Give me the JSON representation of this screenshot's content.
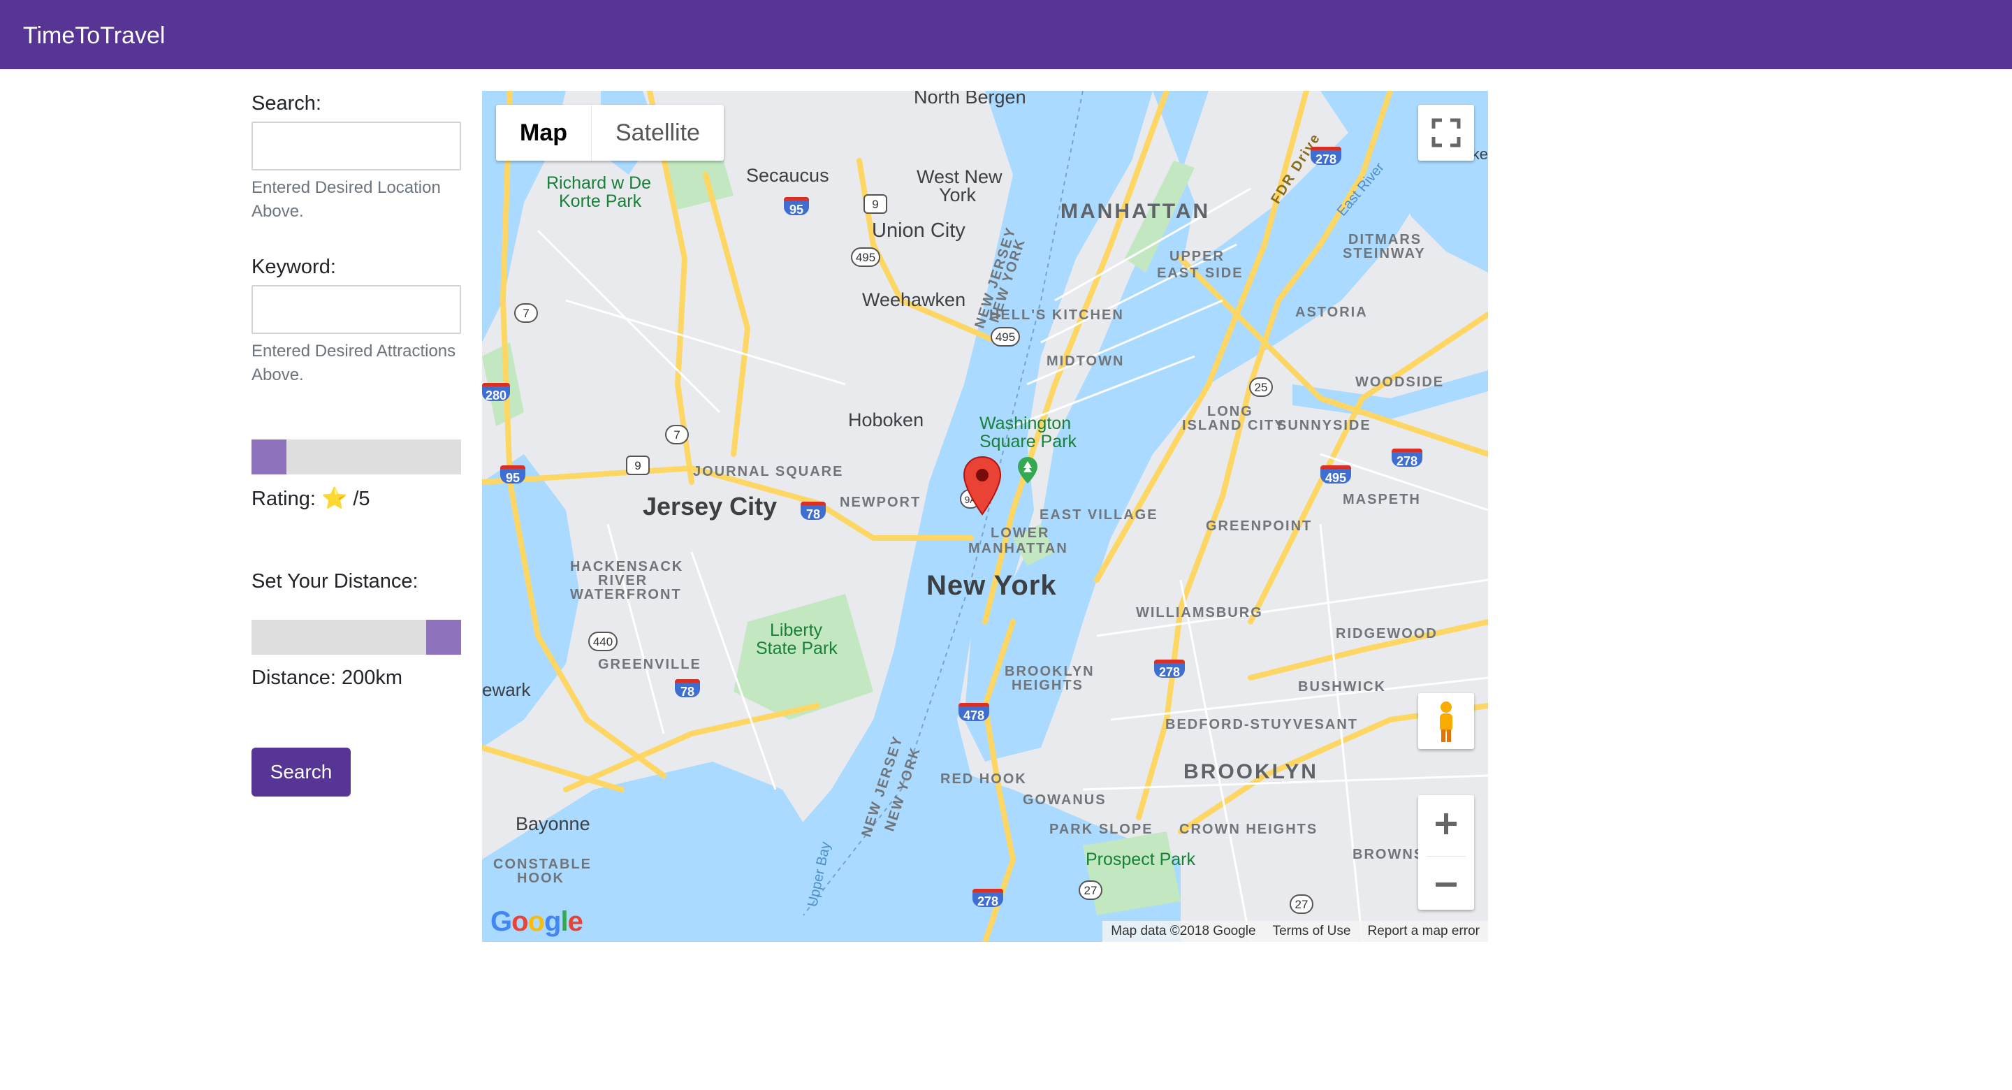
{
  "header": {
    "brand": "TimeToTravel"
  },
  "sidebar": {
    "search": {
      "label": "Search:",
      "value": "",
      "help": "Entered Desired Location Above."
    },
    "keyword": {
      "label": "Keyword:",
      "value": "",
      "help": "Entered Desired Attractions Above."
    },
    "rating": {
      "label_prefix": "Rating:",
      "star": "⭐",
      "label_suffix": "/5",
      "slider_fraction": 0
    },
    "distance": {
      "title": "Set Your Distance:",
      "label": "Distance: 200km",
      "slider_fraction": 1
    },
    "search_button": "Search"
  },
  "map": {
    "type_controls": [
      "Map",
      "Satellite"
    ],
    "active_type": "Map",
    "labels": {
      "north_bergen": "North Bergen",
      "secaucus": "Secaucus",
      "richard": "Richard w De",
      "korte": "Korte Park",
      "west_new_york_1": "West New",
      "west_new_york_2": "York",
      "union_city": "Union City",
      "weehawken": "Weehawken",
      "hoboken": "Hoboken",
      "jersey_city": "Jersey City",
      "new_york": "New York",
      "manhattan": "MANHATTAN",
      "upper_east_1": "UPPER",
      "upper_east_2": "EAST SIDE",
      "hells_kitchen": "HELL'S KITCHEN",
      "midtown": "MIDTOWN",
      "washington_1": "Washington",
      "washington_2": "Square Park",
      "east_village": "EAST VILLAGE",
      "lower_manhattan_1": "LOWER",
      "lower_manhattan_2": "MANHATTAN",
      "journal_square": "JOURNAL SQUARE",
      "newport": "NEWPORT",
      "hackensack_1": "HACKENSACK",
      "hackensack_2": "RIVER",
      "hackensack_3": "WATERFRONT",
      "greenville": "GREENVILLE",
      "liberty_1": "Liberty",
      "liberty_2": "State Park",
      "ewark": "ewark",
      "bayonne": "Bayonne",
      "constable_1": "CONSTABLE",
      "constable_2": "HOOK",
      "upper_bay": "Upper Bay",
      "nj_ny_1": "NEW JERSEY",
      "nj_ny_2": "NEW YORK",
      "astoria": "ASTORIA",
      "ditmars_1": "DITMARS",
      "ditmars_2": "STEINWAY",
      "woodside": "WOODSIDE",
      "long_island_1": "LONG",
      "long_island_2": "ISLAND CITY",
      "sunnyside": "SUNNYSIDE",
      "maspeth": "MASPETH",
      "greenpoint": "GREENPOINT",
      "williamsburg": "WILLIAMSBURG",
      "ridgewood": "RIDGEWOOD",
      "brooklyn_heights_1": "BROOKLYN",
      "brooklyn_heights_2": "HEIGHTS",
      "bushwick": "BUSHWICK",
      "bedford": "BEDFORD-STUYVESANT",
      "brooklyn": "BROOKLYN",
      "red_hook": "RED HOOK",
      "gowanus": "GOWANUS",
      "park_slope": "PARK SLOPE",
      "crown_heights": "CROWN HEIGHTS",
      "prospect_park": "Prospect Park",
      "brownsville": "BROWNSVIL",
      "fdr_drive": "FDR Drive",
      "east_river": "East River",
      "rikers": "Rikers I"
    },
    "shields": {
      "i95a": "95",
      "i95b": "95",
      "i78a": "78",
      "i78b": "78",
      "i278a": "278",
      "i278b": "278",
      "i278c": "278",
      "i278d": "278",
      "i478": "478",
      "i280": "280",
      "i495": "495",
      "us9a": "9",
      "us9b": "9",
      "r495a": "495",
      "r495b": "495",
      "r7a": "7",
      "r7b": "7",
      "r25": "25",
      "r440": "440",
      "r27a": "27",
      "r27b": "27",
      "r9a": "9A"
    },
    "google_logo": "Google",
    "attribution": [
      "Map data ©2018 Google",
      "Terms of Use",
      "Report a map error"
    ],
    "colors": {
      "water": "#aadaff",
      "land": "#e8eaed",
      "park": "#c3e8c1",
      "highway": "#fdd663",
      "marker": "#ea4335"
    }
  }
}
